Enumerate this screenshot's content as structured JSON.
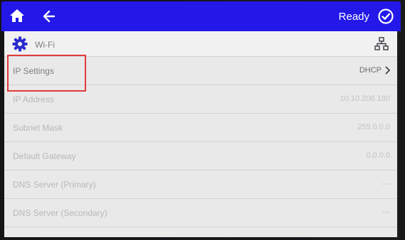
{
  "topbar": {
    "home_icon": "home-icon",
    "back_icon": "arrow-left-icon",
    "status": "Ready",
    "status_icon": "check-circle-icon",
    "color": "#2318e8"
  },
  "header": {
    "icon": "gear-icon",
    "title": "Wi-Fi",
    "network_icon": "network-icon"
  },
  "rows": [
    {
      "label": "IP Settings",
      "value": "DHCP",
      "enabled": true,
      "has_chevron": true
    },
    {
      "label": "IP Address",
      "value": "10.10.206.180",
      "enabled": false
    },
    {
      "label": "Subnet Mask",
      "value": "255.0.0.0",
      "enabled": false
    },
    {
      "label": "Default Gateway",
      "value": "0.0.0.0",
      "enabled": false
    },
    {
      "label": "DNS Server (Primary)",
      "value": "---",
      "enabled": false
    },
    {
      "label": "DNS Server (Secondary)",
      "value": "---",
      "enabled": false
    }
  ],
  "highlight_color": "#e23a3a"
}
